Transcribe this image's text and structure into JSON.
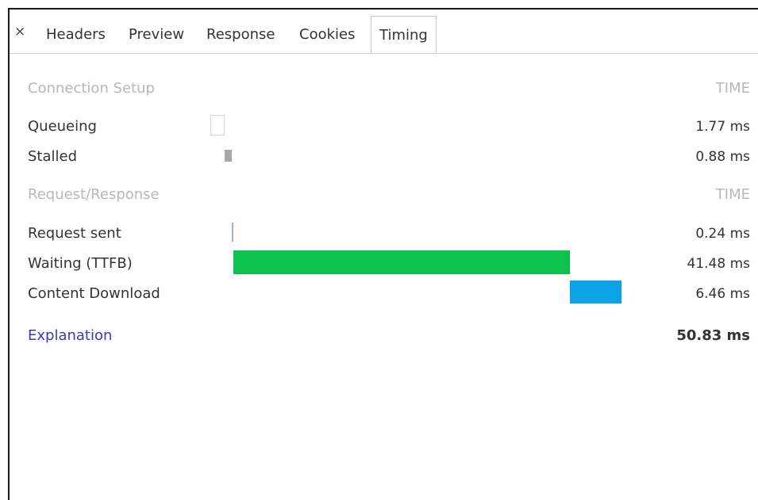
{
  "tabs": {
    "close": "×",
    "items": [
      "Headers",
      "Preview",
      "Response",
      "Cookies",
      "Timing"
    ],
    "active": "Timing"
  },
  "connection_setup": {
    "title": "Connection Setup",
    "time_header": "TIME",
    "rows": [
      {
        "label": "Queueing",
        "value": "1.77 ms",
        "start_ms": 0.0,
        "duration_ms": 1.77,
        "color": "#ffffff"
      },
      {
        "label": "Stalled",
        "value": "0.88 ms",
        "start_ms": 1.77,
        "duration_ms": 0.88,
        "color": "#a8a8a8"
      }
    ]
  },
  "request_response": {
    "title": "Request/Response",
    "time_header": "TIME",
    "rows": [
      {
        "label": "Request sent",
        "value": "0.24 ms",
        "start_ms": 2.65,
        "duration_ms": 0.24,
        "color": "#9fb3c8"
      },
      {
        "label": "Waiting (TTFB)",
        "value": "41.48 ms",
        "start_ms": 2.89,
        "duration_ms": 41.48,
        "color": "#0cc14d"
      },
      {
        "label": "Content Download",
        "value": "6.46 ms",
        "start_ms": 44.37,
        "duration_ms": 6.46,
        "color": "#0aa3e6"
      }
    ]
  },
  "footer": {
    "explanation": "Explanation",
    "total": "50.83 ms",
    "total_ms": 50.83
  },
  "colors": {
    "link": "#3b3bb3",
    "muted": "#b8b8b8"
  }
}
